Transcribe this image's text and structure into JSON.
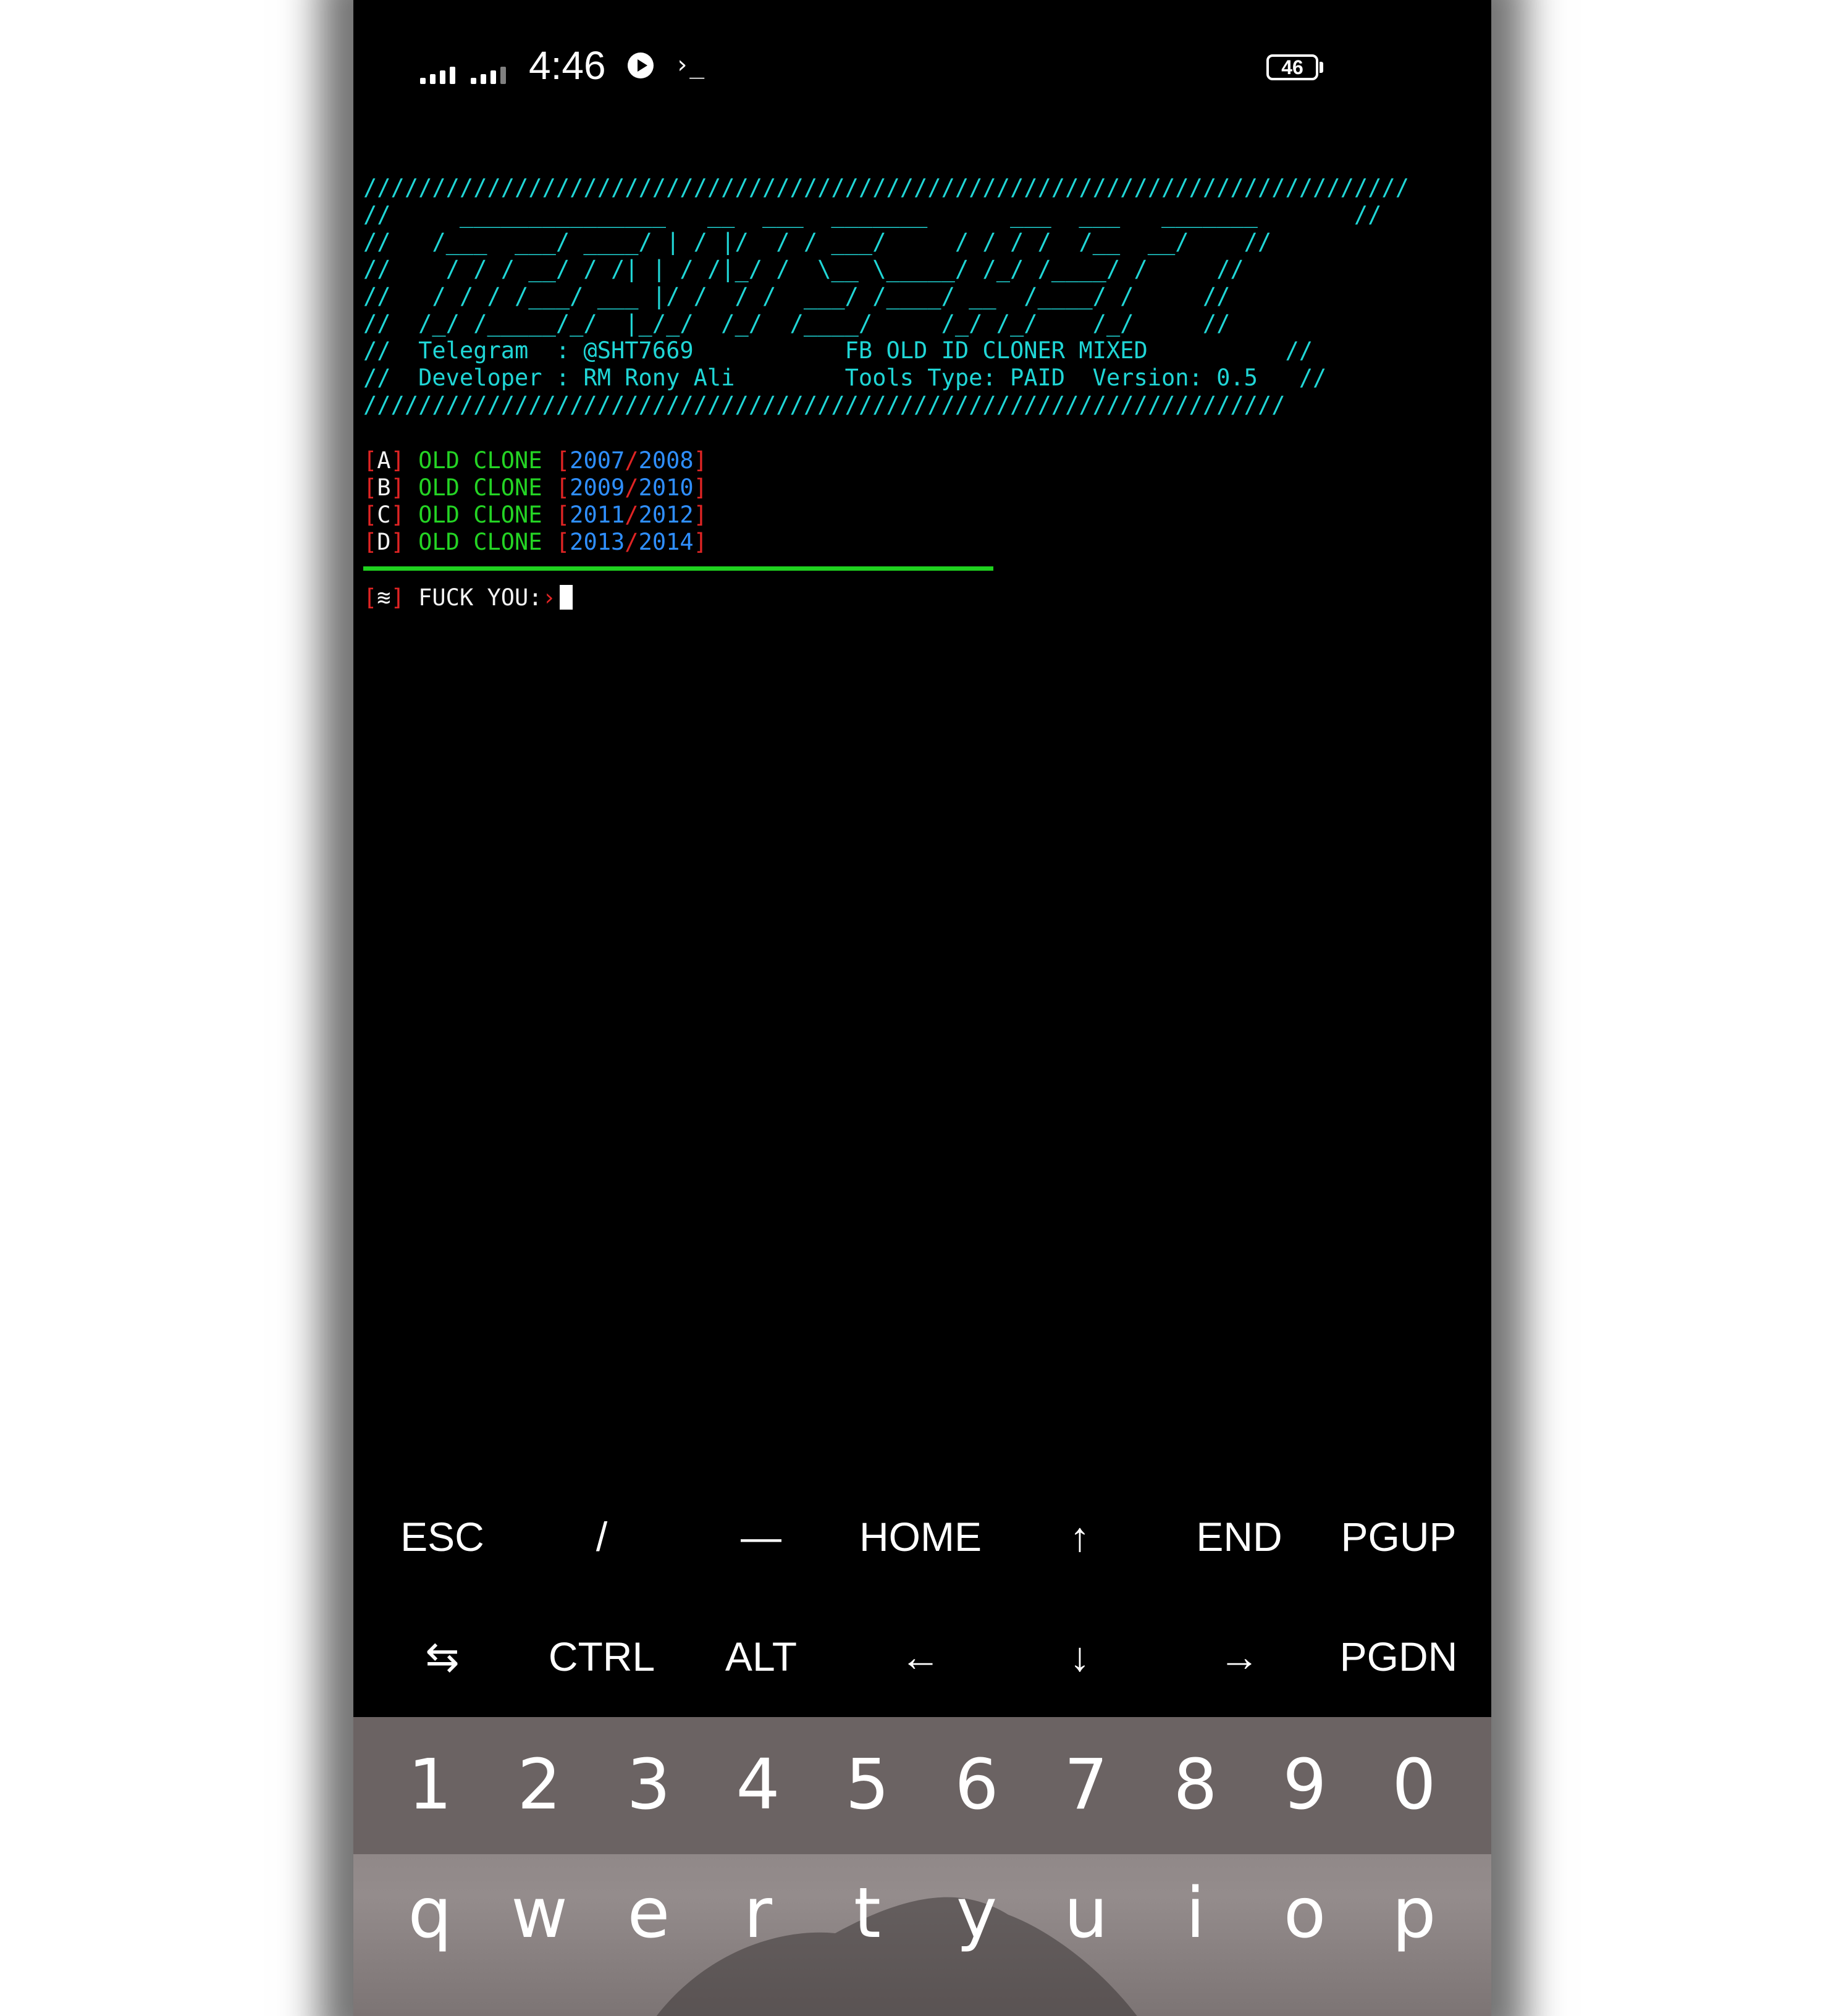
{
  "status_bar": {
    "time": "4:46",
    "battery": "46",
    "terminal_glyph": "›_"
  },
  "terminal": {
    "banner_lines": [
      "////////////////////////////////////////////////////////////////////////////",
      "//     _______________   __  ___  _______      ___  ___   _______       //",
      "//   /___  ___/ ____/ | / |/  / / ___/     / / / /  /__  __/    //",
      "//    / / / __/ / /| | / /|_/ /  \\__ \\_____/ /_/ /____/ /     //",
      "//   / / / /___/ ___ |/ /  / /  ___/ /____/ __  /____/ /     //",
      "//  /_/ /_____/_/  |_/_/  /_/  /____/     /_/ /_/    /_/     //"
    ],
    "info_lines": [
      "//  Telegram  : @SHT7669           FB OLD ID CLONER MIXED          //",
      "//  Developer : RM Rony Ali        Tools Type: PAID  Version: 0.5   //",
      "///////////////////////////////////////////////////////////////////"
    ],
    "menu": [
      {
        "key": "A",
        "label": "OLD CLONE",
        "year1": "2007",
        "year2": "2008"
      },
      {
        "key": "B",
        "label": "OLD CLONE",
        "year1": "2009",
        "year2": "2010"
      },
      {
        "key": "C",
        "label": "OLD CLONE",
        "year1": "2011",
        "year2": "2012"
      },
      {
        "key": "D",
        "label": "OLD CLONE",
        "year1": "2013",
        "year2": "2014"
      }
    ],
    "prompt_symbol": "≋",
    "prompt_text": "FUCK YOU:",
    "prompt_arrow": "›"
  },
  "extra_keys": {
    "row1": [
      "ESC",
      "/",
      "—",
      "HOME",
      "↑",
      "END",
      "PGUP"
    ],
    "row2": [
      "⇆",
      "CTRL",
      "ALT",
      "←",
      "↓",
      "→",
      "PGDN"
    ]
  },
  "keyboard": {
    "numbers": [
      "1",
      "2",
      "3",
      "4",
      "5",
      "6",
      "7",
      "8",
      "9",
      "0"
    ],
    "letters": [
      "q",
      "w",
      "e",
      "r",
      "t",
      "y",
      "u",
      "i",
      "o",
      "p"
    ]
  },
  "colors": {
    "banner": "#20d6d6",
    "bracket": "#e02424",
    "option_label": "#24d424",
    "year": "#2f8fff",
    "divider": "#1fd11f",
    "terminal_bg": "#000000"
  }
}
